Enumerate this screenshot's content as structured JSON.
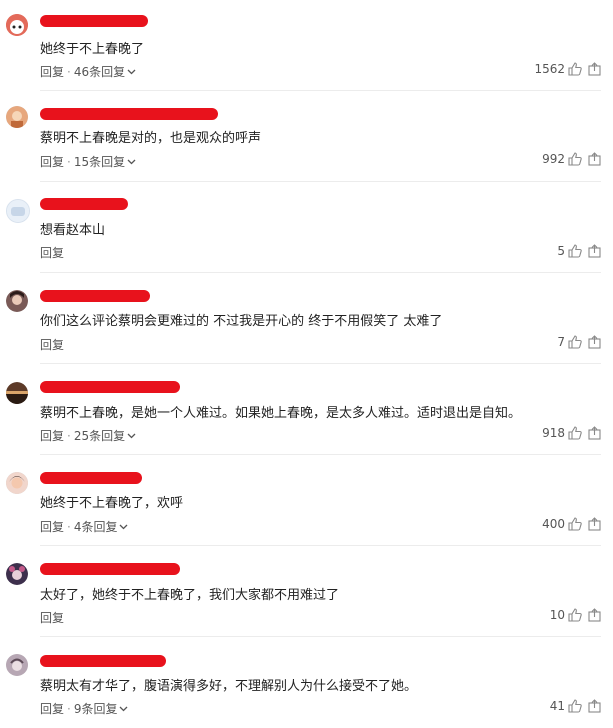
{
  "comments": [
    {
      "text": "她终于不上春晚了",
      "reply_label": "回复",
      "replies_label": "46条回复",
      "likes": "1562",
      "avatar_color": "#e36a5a",
      "name_ghost": "",
      "name_color": "#e8121c"
    },
    {
      "text": "蔡明不上春晚是对的，也是观众的呼声",
      "reply_label": "回复",
      "replies_label": "15条回复",
      "likes": "992",
      "avatar_color": "#e7a77d",
      "name_ghost": "",
      "name_color": "#e8121c"
    },
    {
      "text": "想看赵本山",
      "reply_label": "回复",
      "replies_label": "",
      "likes": "5",
      "avatar_color": "#c9d7e8",
      "name_ghost": "",
      "name_color": "#e8121c"
    },
    {
      "text": "你们这么评论蔡明会更难过的 不过我是开心的 终于不用假笑了 太难了",
      "reply_label": "回复",
      "replies_label": "",
      "likes": "7",
      "avatar_color": "#7a5a57",
      "name_ghost": "",
      "name_color": "#e8121c"
    },
    {
      "text": "蔡明不上春晚，是她一个人难过。如果她上春晚，是太多人难过。适时退出是自知。",
      "reply_label": "回复",
      "replies_label": "25条回复",
      "likes": "918",
      "avatar_color": "#5d3a28",
      "name_ghost": "",
      "name_color": "#e8121c"
    },
    {
      "text": "她终于不上春晚了，欢呼",
      "reply_label": "回复",
      "replies_label": "4条回复",
      "likes": "400",
      "avatar_color": "#d98b7c",
      "name_ghost": "",
      "name_color": "#e8121c"
    },
    {
      "text": "太好了，她终于不上春晚了，我们大家都不用难过了",
      "reply_label": "回复",
      "replies_label": "",
      "likes": "10",
      "avatar_color": "#3d2f4c",
      "name_ghost": "",
      "name_color": "#e8121c"
    },
    {
      "text": "蔡明太有才华了，腹语演得多好，不理解别人为什么接受不了她。",
      "reply_label": "回复",
      "replies_label": "9条回复",
      "likes": "41",
      "avatar_color": "#b7a7b4",
      "name_ghost": "",
      "name_color": "#e8121c"
    }
  ],
  "icons": {
    "like": "thumbs-up-icon",
    "share": "share-icon",
    "expand": "chevron-down-icon"
  }
}
